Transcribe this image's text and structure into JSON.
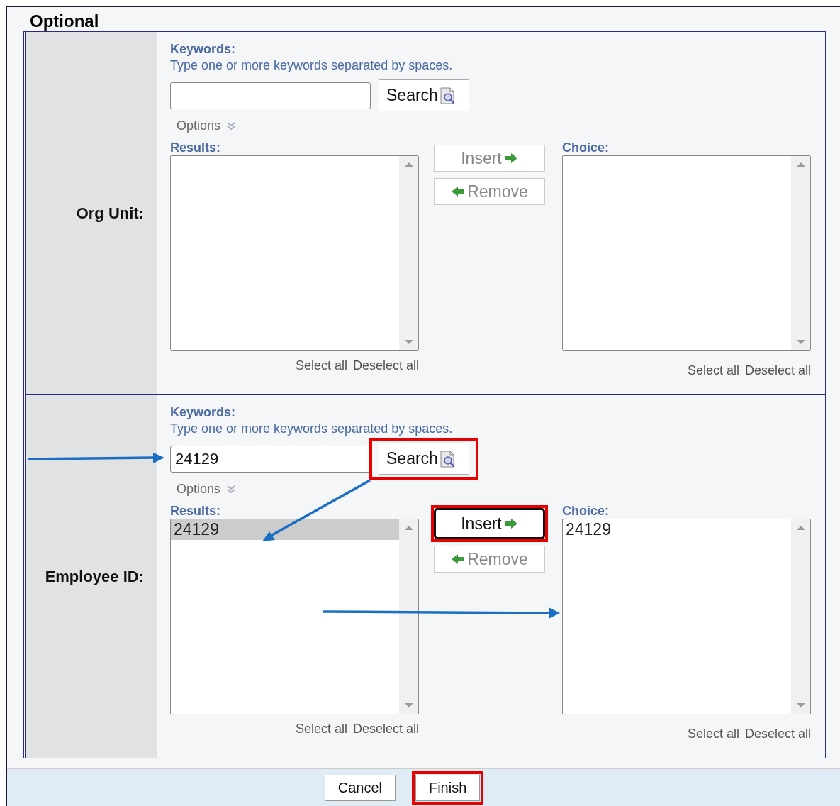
{
  "heading": "Optional",
  "sections": [
    {
      "label": "Org Unit:",
      "keywords_label": "Keywords:",
      "hint": "Type one or more keywords separated by spaces.",
      "search": {
        "label": "Search",
        "highlighted": false
      },
      "options_label": "Options",
      "results_label": "Results:",
      "insert": {
        "label": "Insert",
        "disabled": true,
        "focused": false,
        "highlighted": false
      },
      "remove": {
        "label": "Remove",
        "disabled": true
      },
      "choice_label": "Choice:",
      "results_links": [
        "Select all",
        "Deselect all"
      ],
      "choice_links": [
        "Select all",
        "Deselect all"
      ]
    },
    {
      "label": "Employee ID:",
      "keywords_label": "Keywords:",
      "hint": "Type one or more keywords separated by spaces.",
      "keyword_value": "24129",
      "search": {
        "label": "Search",
        "highlighted": true
      },
      "options_label": "Options",
      "results_label": "Results:",
      "results": [
        {
          "text": "24129",
          "selected": true
        }
      ],
      "insert": {
        "label": "Insert",
        "disabled": false,
        "focused": true,
        "highlighted": true
      },
      "remove": {
        "label": "Remove",
        "disabled": true
      },
      "choice_label": "Choice:",
      "choices": [
        {
          "text": "24129",
          "selected": false
        }
      ],
      "results_links": [
        "Select all",
        "Deselect all"
      ],
      "choice_links": [
        "Select all",
        "Deselect all"
      ]
    }
  ],
  "footer_buttons": [
    {
      "label": "Cancel",
      "highlighted": false
    },
    {
      "label": "Finish",
      "highlighted": true
    }
  ]
}
